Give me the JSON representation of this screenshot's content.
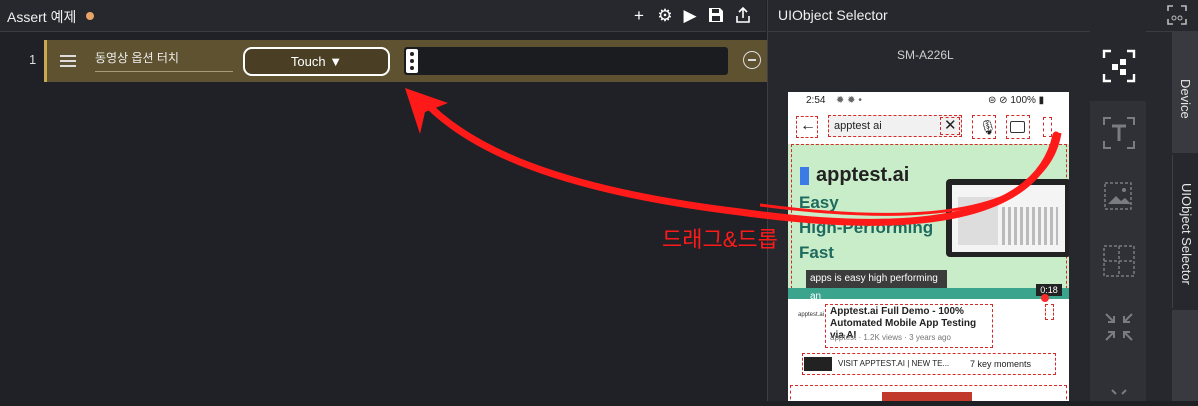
{
  "left_panel": {
    "title": "Assert 예제"
  },
  "step": {
    "number": "1",
    "name": "동영상 옵션 터치",
    "action_label": "Touch ▼"
  },
  "right_panel": {
    "title": "UIObject Selector",
    "device_name": "SM-A226L"
  },
  "tabs": {
    "device": "Device",
    "uiobject": "UIObject Selector"
  },
  "phone": {
    "status_time": "2:54",
    "status_right": "100%",
    "search_text": "apptest ai",
    "banner_brand": "apptest.ai",
    "banner_lines": [
      "Easy",
      "High-Performing",
      "Fast"
    ],
    "video_caption": "apps is easy high performing an",
    "video_duration": "0:18",
    "video_title": "Apptest.ai Full Demo - 100% Automated Mobile App Testing via AI",
    "video_meta": "apptest · 1.2K views · 3 years ago",
    "channel_logo": "apptest.ai",
    "visit_text": "VISIT APPTEST.AI | NEW TE...",
    "key_moments": "7 key moments"
  },
  "annotation": {
    "drag_drop_label": "드래그&드롭",
    "color": "#ff1a1a"
  }
}
